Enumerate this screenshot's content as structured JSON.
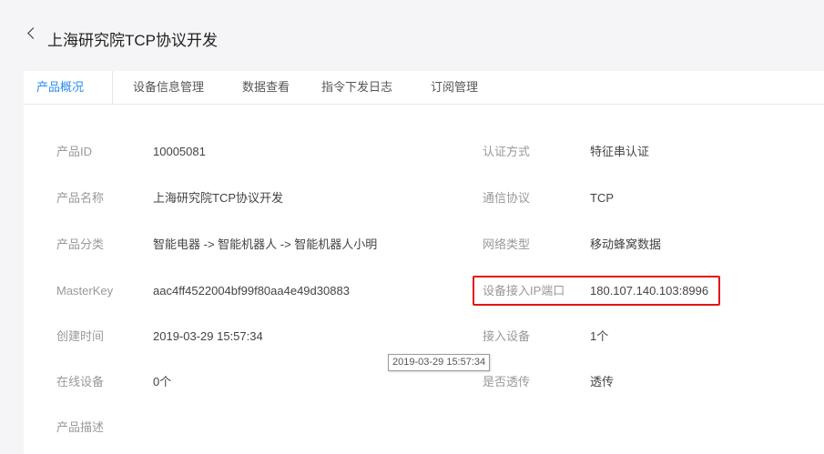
{
  "header": {
    "title": "上海研究院TCP协议开发"
  },
  "tabs": [
    {
      "label": "产品概况"
    },
    {
      "label": "设备信息管理"
    },
    {
      "label": "数据查看"
    },
    {
      "label": "指令下发日志"
    },
    {
      "label": "订阅管理"
    }
  ],
  "left_fields": [
    {
      "label": "产品ID",
      "value": "10005081"
    },
    {
      "label": "产品名称",
      "value": "上海研究院TCP协议开发"
    },
    {
      "label": "产品分类",
      "value": "智能电器 -> 智能机器人 -> 智能机器人小明"
    },
    {
      "label": "MasterKey",
      "value": "aac4ff4522004bf99f80aa4e49d30883"
    },
    {
      "label": "创建时间",
      "value": "2019-03-29 15:57:34"
    },
    {
      "label": "在线设备",
      "value": "0个"
    },
    {
      "label": "产品描述",
      "value": ""
    }
  ],
  "right_fields": [
    {
      "label": "认证方式",
      "value": "特征串认证"
    },
    {
      "label": "通信协议",
      "value": "TCP"
    },
    {
      "label": "网络类型",
      "value": "移动蜂窝数据"
    },
    {
      "label": "设备接入IP端口",
      "value": "180.107.140.103:8996"
    },
    {
      "label": "接入设备",
      "value": "1个"
    },
    {
      "label": "是否透传",
      "value": "透传"
    }
  ],
  "tooltip": {
    "text": "2019-03-29 15:57:34"
  },
  "colors": {
    "accent": "#2d8cf0",
    "highlight_border": "#e31414",
    "page_bg": "#f5f5f7"
  }
}
